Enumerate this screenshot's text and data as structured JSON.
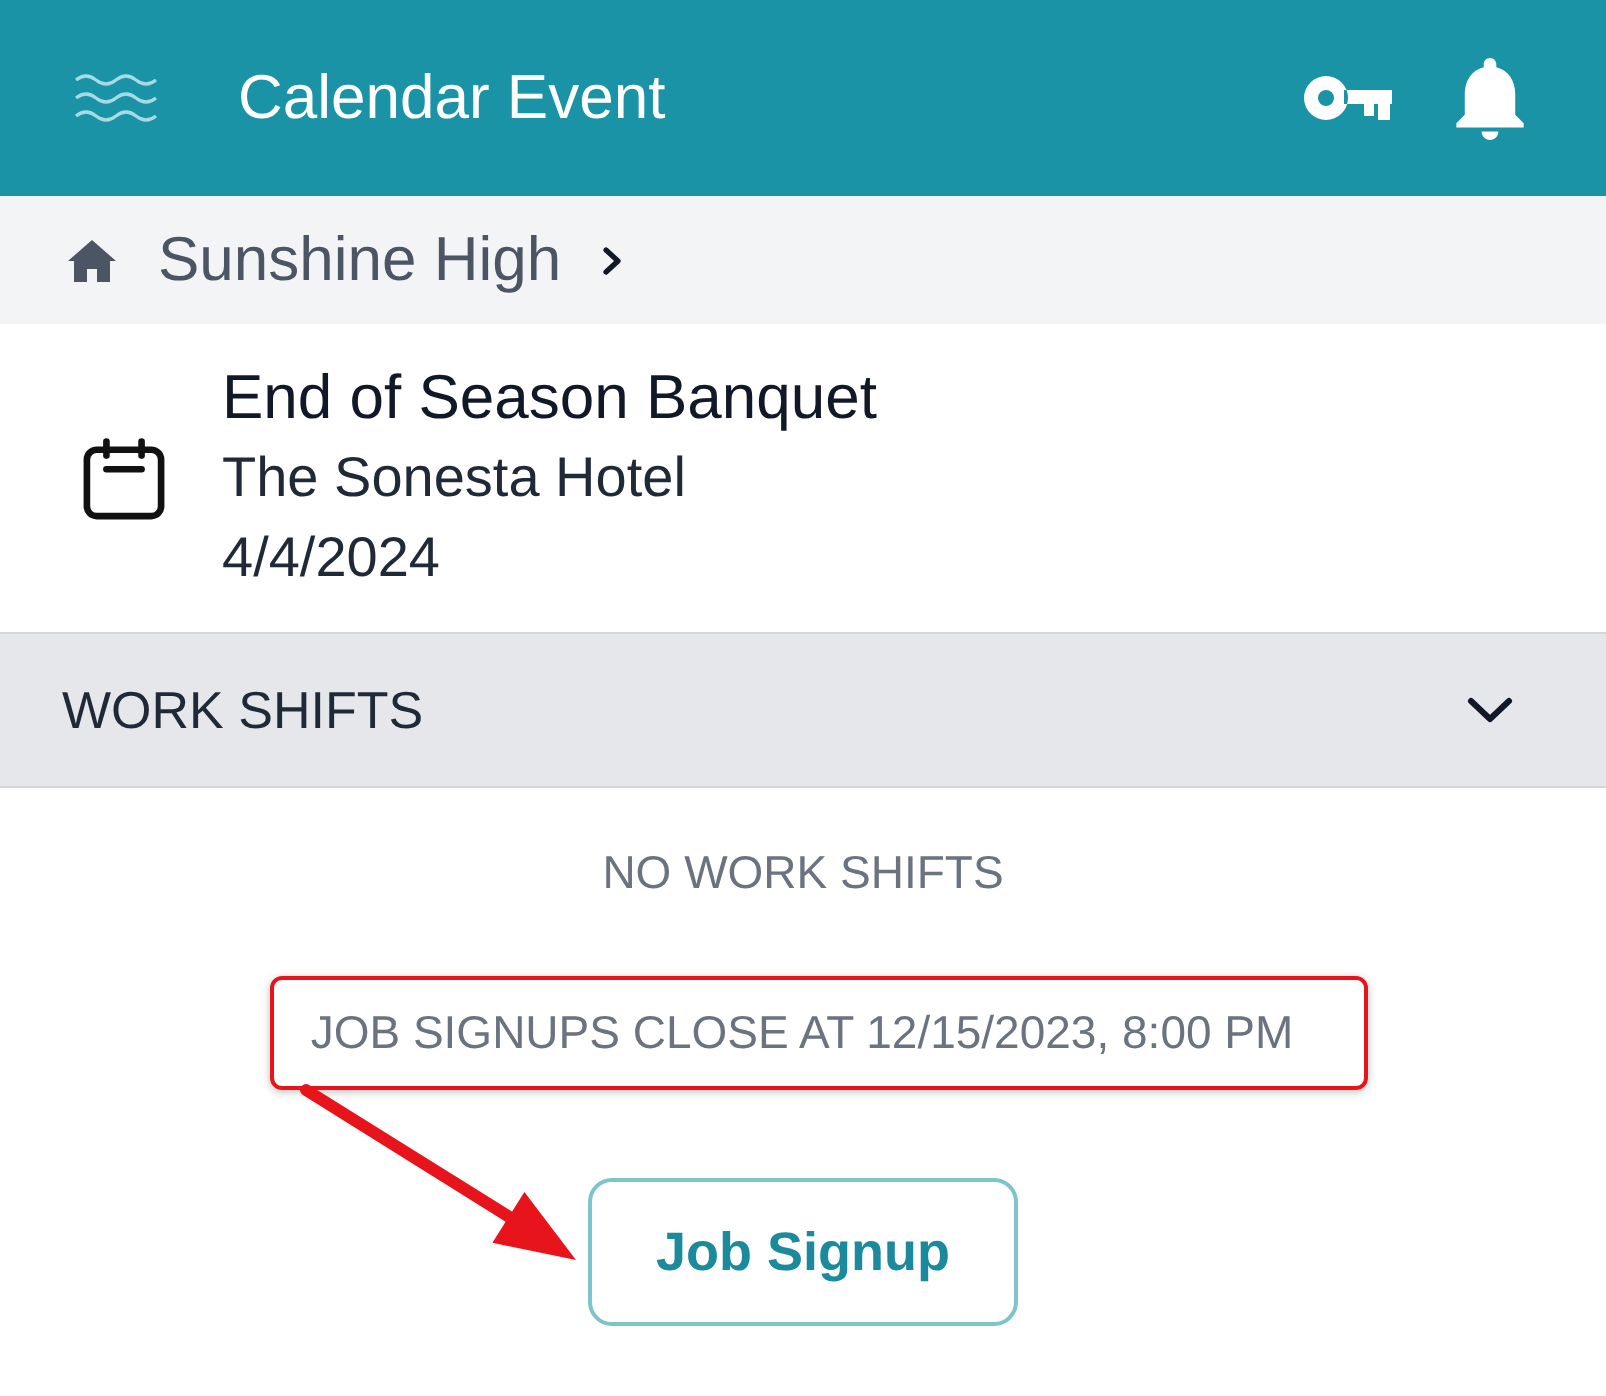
{
  "app_bar": {
    "title": "Calendar Event"
  },
  "breadcrumb": {
    "label": "Sunshine High"
  },
  "event": {
    "title": "End of Season Banquet",
    "location": "The Sonesta Hotel",
    "date": "4/4/2024"
  },
  "work_shifts": {
    "heading": "WORK SHIFTS",
    "expanded": true,
    "empty_message": "NO WORK SHIFTS",
    "signup_notice": {
      "text": "JOB SIGNUPS CLOSE AT 12/15/2023, 8:00 PM",
      "highlighted": true
    },
    "signup_button": {
      "label": "Job Signup",
      "pointed_at": true
    }
  }
}
